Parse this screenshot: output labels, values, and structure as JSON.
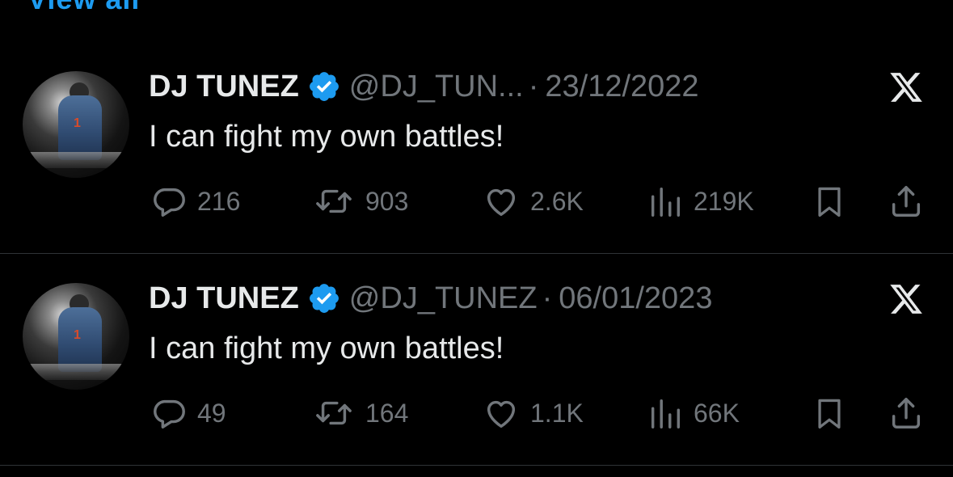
{
  "top_link": {
    "label": "View all"
  },
  "tweets": [
    {
      "display_name": "DJ TUNEZ",
      "handle": "@DJ_TUN...",
      "separator": "·",
      "date": "23/12/2022",
      "text": "I can fight my own battles!",
      "avatar_number": "1",
      "replies": "216",
      "retweets": "903",
      "likes": "2.6K",
      "views": "219K"
    },
    {
      "display_name": "DJ TUNEZ",
      "handle": "@DJ_TUNEZ",
      "separator": "·",
      "date": "06/01/2023",
      "text": "I can fight my own battles!",
      "avatar_number": "1",
      "replies": "49",
      "retweets": "164",
      "likes": "1.1K",
      "views": "66K"
    }
  ],
  "icons": {
    "verified": "verified-badge-icon",
    "platform": "x-logo-icon",
    "reply": "reply-icon",
    "retweet": "retweet-icon",
    "like": "heart-icon",
    "views": "views-icon",
    "bookmark": "bookmark-icon",
    "share": "share-icon"
  },
  "colors": {
    "background": "#000000",
    "primary_text": "#e7e9ea",
    "secondary_text": "#71767b",
    "accent": "#1d9bf0",
    "divider": "#2f3336"
  }
}
